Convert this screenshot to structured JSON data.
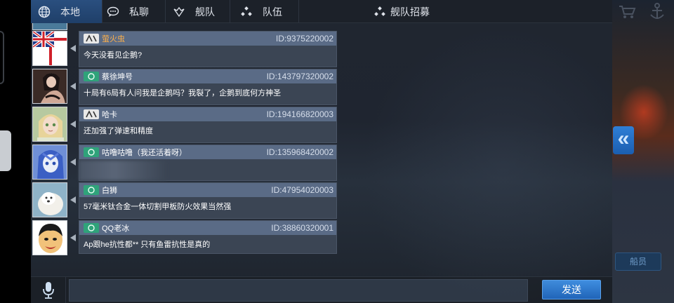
{
  "tabs": [
    {
      "label": "本地",
      "icon": "globe-icon",
      "active": true
    },
    {
      "label": "私聊",
      "icon": "chat-bubble-icon",
      "active": false
    },
    {
      "label": "舰队",
      "icon": "fleet-icon",
      "active": false
    },
    {
      "label": "队伍",
      "icon": "team-icon",
      "active": false
    },
    {
      "label": "舰队招募",
      "icon": "recruit-icon",
      "active": false
    }
  ],
  "messages": [
    {
      "name": "萤火虫",
      "uid": "ID:9375220002",
      "text": "今天没看见企鹅?",
      "rank_icon": "rank-badge-icon",
      "avatar": "union-flag-avatar",
      "name_color": "#ffb04a"
    },
    {
      "name": "蔡徐坤号",
      "uid": "ID:143797320002",
      "text": "十局有6局有人问我是企鹅吗？我裂了，企鹅到底何方神圣",
      "rank_icon": "rank-badge-icon",
      "avatar": "character-avatar",
      "name_color": "#ffffff"
    },
    {
      "name": "哈卡",
      "uid": "ID:194166820003",
      "text": "还加强了弹速和精度",
      "rank_icon": "rank-badge-icon",
      "avatar": "character-avatar",
      "name_color": "#ffffff"
    },
    {
      "name": "咕噜咕噜（我还活着呀）",
      "uid": "ID:135968420002",
      "text": "",
      "rank_icon": "rank-badge-icon",
      "avatar": "character-avatar",
      "name_color": "#ffffff"
    },
    {
      "name": "白狮",
      "uid": "ID:47954020003",
      "text": "57毫米钛合金一体切割甲板防火效果当然强",
      "rank_icon": "rank-badge-icon",
      "avatar": "white-lion-avatar",
      "name_color": "#ffffff"
    },
    {
      "name": "QQ老冰",
      "uid": "ID:38860320001",
      "text": "Ap跟he抗性都**  只有鱼雷抗性是真的",
      "rank_icon": "rank-badge-icon",
      "avatar": "meme-face-avatar",
      "name_color": "#ffffff"
    }
  ],
  "input": {
    "placeholder": "",
    "value": ""
  },
  "send_label": "发送",
  "side": {
    "collapse_glyph": "«",
    "button_label": "船员"
  },
  "colors": {
    "active_tab": "#2a4f7f",
    "send_button": "#2f7ad0",
    "orange_name": "#ffb04a"
  }
}
